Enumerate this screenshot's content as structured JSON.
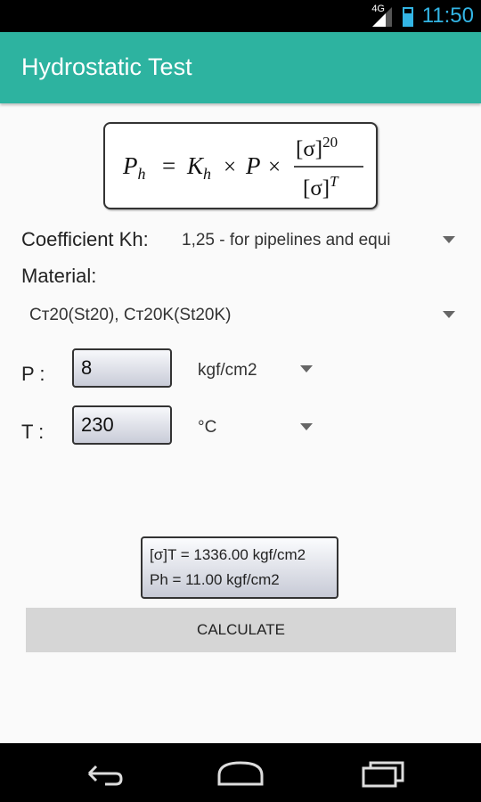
{
  "status_bar": {
    "network": "4G",
    "time": "11:50"
  },
  "app_bar": {
    "title": "Hydrostatic Test"
  },
  "formula": {
    "lhs": "P",
    "lhs_sub": "h",
    "k": "K",
    "k_sub": "h",
    "p": "P",
    "sigma": "[σ]",
    "sup_num": "20",
    "sup_den": "T"
  },
  "coefficient": {
    "label": "Coefficient Kh:",
    "value": "1,25 - for pipelines and equi"
  },
  "material": {
    "label": "Material:",
    "value": "Ст20(St20), Ст20K(St20K)"
  },
  "pressure": {
    "label": "P :",
    "value": "8",
    "unit": "kgf/cm2"
  },
  "temperature": {
    "label": "T :",
    "value": "230",
    "unit": "°C"
  },
  "result": {
    "line1": "[σ]T = 1336.00 kgf/cm2",
    "line2": "Ph = 11.00 kgf/cm2"
  },
  "calculate_button": {
    "label": "CALCULATE"
  },
  "navigation": {
    "back": "back-icon",
    "home": "home-icon",
    "recents": "recents-icon"
  }
}
